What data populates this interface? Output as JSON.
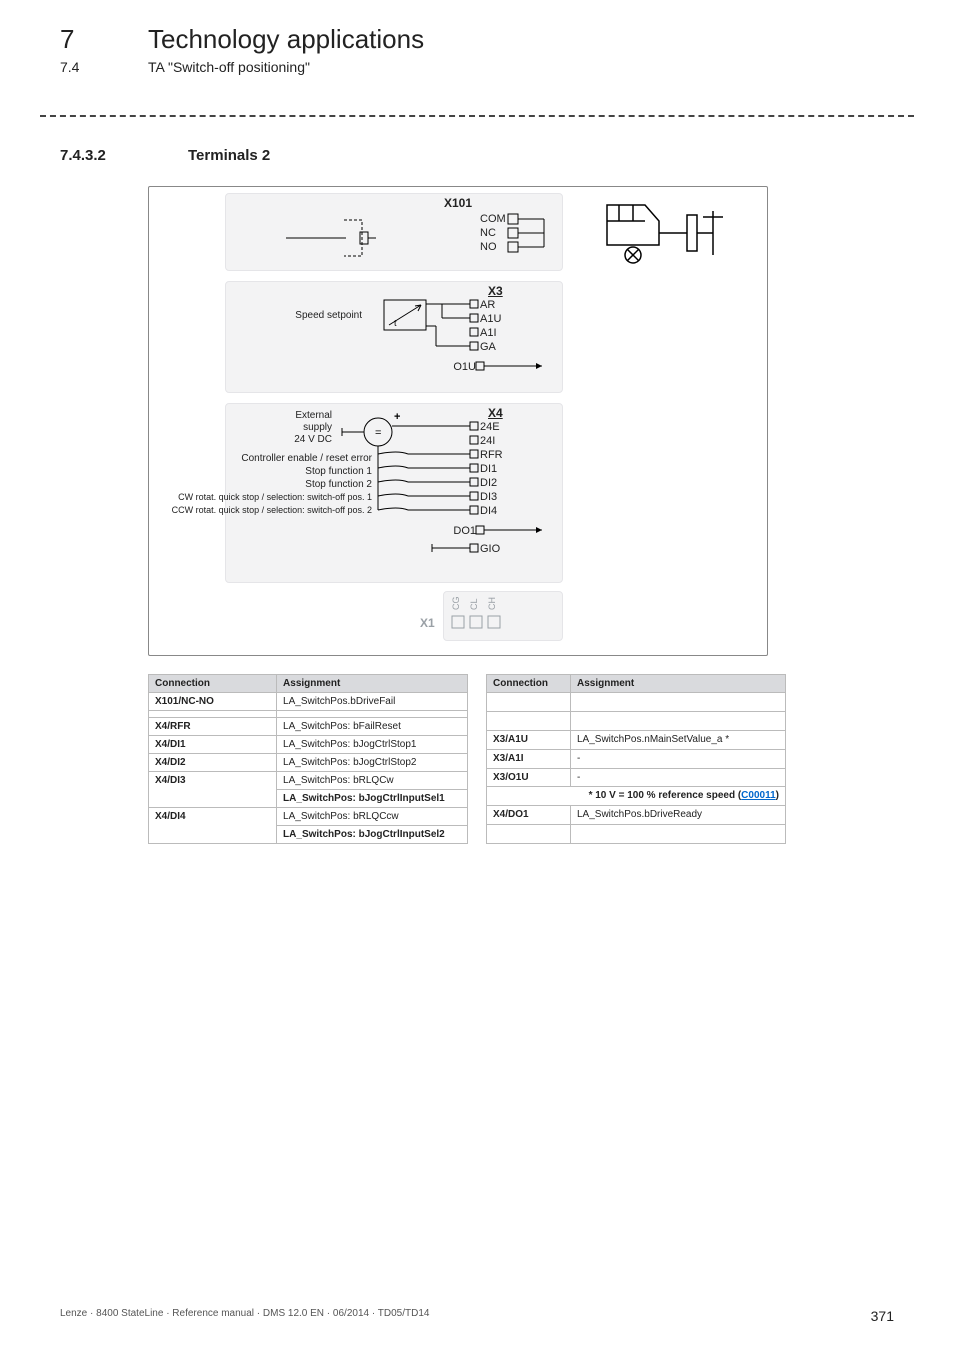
{
  "header": {
    "chapter_number": "7",
    "chapter_title": "Technology applications",
    "section_number": "7.4",
    "section_title": "TA \"Switch-off positioning\""
  },
  "subsection": {
    "number": "7.4.3.2",
    "title": "Terminals 2"
  },
  "diagram": {
    "blocks": {
      "X101": {
        "title": "X101",
        "pins": [
          "COM",
          "NC",
          "NO"
        ]
      },
      "X3": {
        "title": "X3",
        "pins": [
          "AR",
          "A1U",
          "A1I",
          "GA",
          "O1U"
        ],
        "left_label": "Speed setpoint"
      },
      "X4": {
        "title": "X4",
        "pins": [
          "24E",
          "24I",
          "RFR",
          "DI1",
          "DI2",
          "DI3",
          "DI4",
          "DO1",
          "GIO"
        ],
        "left_labels": [
          "External",
          "supply",
          "24 V DC",
          "Controller enable / reset error",
          "Stop function 1",
          "Stop function 2",
          "CW rotat. quick stop / selection: switch-off pos. 1",
          "CCW rotat. quick stop / selection: switch-off pos. 2"
        ],
        "plus": "+",
        "eq": "="
      },
      "X1": {
        "title": "X1",
        "pins": [
          "CG",
          "CL",
          "CH"
        ]
      }
    }
  },
  "tables": {
    "left": {
      "headers": [
        "Connection",
        "Assignment"
      ],
      "rows": [
        [
          "X101/NC-NO",
          "LA_SwitchPos.bDriveFail"
        ],
        [
          "",
          ""
        ],
        [
          "X4/RFR",
          "LA_SwitchPos: bFailReset"
        ],
        [
          "X4/DI1",
          "LA_SwitchPos: bJogCtrlStop1"
        ],
        [
          "X4/DI2",
          "LA_SwitchPos: bJogCtrlStop2"
        ],
        [
          "X4/DI3",
          "LA_SwitchPos: bRLQCw"
        ],
        [
          "",
          "LA_SwitchPos: bJogCtrlInputSel1"
        ],
        [
          "X4/DI4",
          "LA_SwitchPos: bRLQCcw"
        ],
        [
          "",
          "LA_SwitchPos: bJogCtrlInputSel2"
        ]
      ]
    },
    "right": {
      "headers": [
        "Connection",
        "Assignment"
      ],
      "rows": [
        [
          "",
          ""
        ],
        [
          "",
          ""
        ],
        [
          "X3/A1U",
          "LA_SwitchPos.nMainSetValue_a *"
        ],
        [
          "X3/A1I",
          "-"
        ],
        [
          "X3/O1U",
          "-"
        ]
      ],
      "note_prefix": "* 10 V = 100 % reference speed (",
      "note_link": "C00011",
      "note_suffix": ")",
      "tail_rows": [
        [
          "X4/DO1",
          "LA_SwitchPos.bDriveReady"
        ],
        [
          "",
          ""
        ]
      ]
    }
  },
  "footer": {
    "left": "Lenze · 8400 StateLine · Reference manual · DMS 12.0 EN · 06/2014 · TD05/TD14",
    "page": "371"
  }
}
